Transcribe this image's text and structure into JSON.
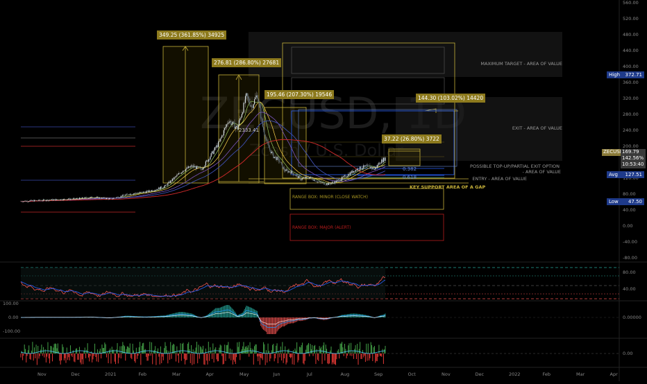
{
  "chart_data": {
    "type": "candlestick",
    "title": "ZECUSD, 1D",
    "subtitle": "Zcash / U.S. Dollar",
    "x_ticks": [
      "Nov",
      "Dec",
      "2021",
      "Feb",
      "Mar",
      "Apr",
      "May",
      "Jun",
      "Jul",
      "Aug",
      "Sep",
      "Oct",
      "Nov",
      "Dec",
      "2022",
      "Feb",
      "Mar",
      "Apr"
    ],
    "y_ticks": [
      "560.00",
      "520.00",
      "480.00",
      "440.00",
      "400.00",
      "360.00",
      "320.00",
      "280.00",
      "240.00",
      "200.00",
      "160.00",
      "120.00",
      "80.00",
      "40.00",
      "0.00",
      "-40.00",
      "-80.00"
    ],
    "price_path": [
      [
        0,
        62
      ],
      [
        10,
        64
      ],
      [
        20,
        66
      ],
      [
        30,
        68
      ],
      [
        40,
        72
      ],
      [
        50,
        68
      ],
      [
        60,
        80
      ],
      [
        70,
        86
      ],
      [
        75,
        92
      ],
      [
        80,
        100
      ],
      [
        85,
        120
      ],
      [
        90,
        140
      ],
      [
        95,
        150
      ],
      [
        100,
        142
      ],
      [
        105,
        175
      ],
      [
        110,
        210
      ],
      [
        115,
        265
      ],
      [
        120,
        245
      ],
      [
        125,
        325
      ],
      [
        128,
        300
      ],
      [
        131,
        330
      ],
      [
        134,
        250
      ],
      [
        137,
        200
      ],
      [
        140,
        175
      ],
      [
        143,
        165
      ],
      [
        146,
        140
      ],
      [
        150,
        135
      ],
      [
        155,
        118
      ],
      [
        160,
        122
      ],
      [
        165,
        110
      ],
      [
        170,
        105
      ],
      [
        175,
        112
      ],
      [
        180,
        125
      ],
      [
        185,
        140
      ],
      [
        190,
        148
      ],
      [
        193,
        150
      ],
      [
        196,
        142
      ],
      [
        199,
        160
      ],
      [
        202,
        170
      ]
    ],
    "price_range": [
      -80,
      560
    ],
    "measure_labels": [
      {
        "text": "349.25 (361.85%) 34925",
        "at": [
          70,
          405
        ]
      },
      {
        "text": "276.81 (286.80%) 27681",
        "at": [
          95,
          345
        ]
      },
      {
        "text": "195.46 (207.30%) 19546",
        "at": [
          137,
          245
        ]
      },
      {
        "text": "144.30 (103.02%) 14420",
        "at": [
          210,
          253
        ]
      },
      {
        "text": "37.22 (26.80%) 3722",
        "at": [
          195,
          177
        ]
      }
    ],
    "peak_label": "2333.41",
    "fib_labels": [
      "0.382",
      "0.618"
    ],
    "annotations": {
      "max_target": "MAXIMUM TARGET - AREA OF VALUE",
      "exit": "EXIT - AREA OF VALUE",
      "partial_exit": "POSSIBLE TOP-UP/PARTIAL EXIT OPTION",
      "area_of_value": "- AREA OF VALUE",
      "entry": "ENTRY - AREA OF VALUE",
      "key_support": "KEY SUPPORT AREA OF A GAP",
      "range_minor": "RANGE BOX: MINOR (CLOSE WATCH)",
      "range_major": "RANGE BOX: MAJOR (ALERT)"
    },
    "price_tags": {
      "high": {
        "label": "High",
        "value": "372.71",
        "at": 372.71
      },
      "symbol": {
        "label": "ZECUSD",
        "value": "169.79",
        "pct": "142.56%",
        "time": "10:53:40",
        "at": 169.79
      },
      "avg": {
        "label": "Avg",
        "value": "127.51",
        "at": 127.51
      },
      "low": {
        "label": "Low",
        "value": "47.50",
        "at": 47.5
      }
    },
    "indicator_ticks": {
      "rsi": [
        "80.00",
        "40.00"
      ],
      "macd_left": [
        "100.00",
        "0.00",
        "-100.00"
      ],
      "macd_right": "0.00000",
      "volume": "0.00"
    }
  },
  "colors": {
    "background": "#000000",
    "up": "#26a69a",
    "down": "#ef5350",
    "gold": "#c8b23a",
    "label_gold": "#8d7a1d",
    "blue": "#2962ff",
    "navy_tag": "#1e3a8a"
  }
}
